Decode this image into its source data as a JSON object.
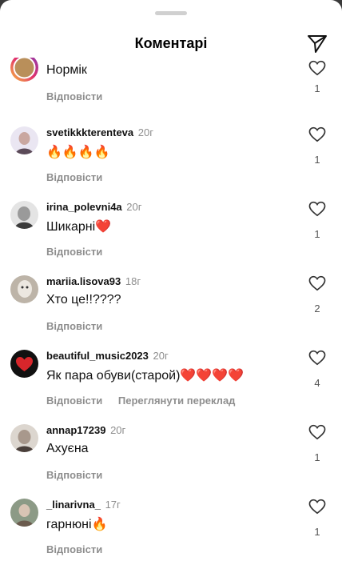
{
  "header": {
    "title": "Коментарі"
  },
  "actions": {
    "reply": "Відповісти",
    "translate": "Переглянути переклад"
  },
  "comments": [
    {
      "username": "",
      "time": "",
      "text": "Нормік",
      "likes": "1",
      "avatar_color": "#b98f5a"
    },
    {
      "username": "svetikkkterenteva",
      "time": "20г",
      "text": "🔥🔥🔥🔥",
      "likes": "1",
      "avatar_color": "#c9a7a0"
    },
    {
      "username": "irina_polevni4a",
      "time": "20г",
      "text": "Шикарні❤️",
      "likes": "1",
      "avatar_color": "#9a9a9a"
    },
    {
      "username": "mariia.lisova93",
      "time": "18г",
      "text": "Хто це!!????",
      "likes": "2",
      "avatar_color": "#bdb4a8"
    },
    {
      "username": "beautiful_music2023",
      "time": "20г",
      "text": "Як пара обуви(старой)❤️❤️❤️❤️",
      "likes": "4",
      "avatar_color": "#111111"
    },
    {
      "username": "annap17239",
      "time": "20г",
      "text": "Ахуєна",
      "likes": "1",
      "avatar_color": "#a8988c"
    },
    {
      "username": "_linarivna_",
      "time": "17г",
      "text": "гарнюні🔥",
      "likes": "1",
      "avatar_color": "#8c9a86"
    }
  ]
}
